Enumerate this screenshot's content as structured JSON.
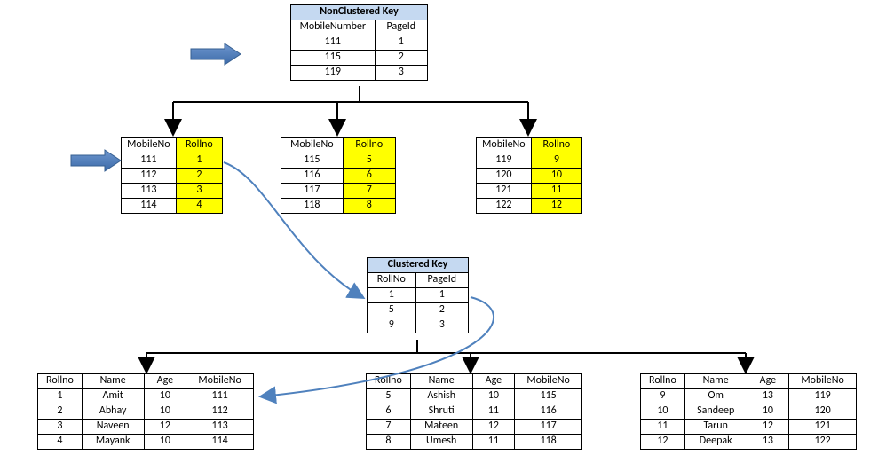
{
  "nonclustered": {
    "title": "NonClustered Key",
    "cols": [
      "MobileNumber",
      "PageId"
    ],
    "rows": [
      [
        "111",
        "1"
      ],
      [
        "115",
        "2"
      ],
      [
        "119",
        "3"
      ]
    ]
  },
  "leaf_nc": {
    "cols": [
      "MobileNo",
      "Rollno"
    ],
    "pages": [
      [
        [
          "111",
          "1"
        ],
        [
          "112",
          "2"
        ],
        [
          "113",
          "3"
        ],
        [
          "114",
          "4"
        ]
      ],
      [
        [
          "115",
          "5"
        ],
        [
          "116",
          "6"
        ],
        [
          "117",
          "7"
        ],
        [
          "118",
          "8"
        ]
      ],
      [
        [
          "119",
          "9"
        ],
        [
          "120",
          "10"
        ],
        [
          "121",
          "11"
        ],
        [
          "122",
          "12"
        ]
      ]
    ]
  },
  "clustered": {
    "title": "Clustered Key",
    "cols": [
      "RollNo",
      "PageId"
    ],
    "rows": [
      [
        "1",
        "1"
      ],
      [
        "5",
        "2"
      ],
      [
        "9",
        "3"
      ]
    ]
  },
  "data_pages": {
    "cols": [
      "Rollno",
      "Name",
      "Age",
      "MobileNo"
    ],
    "pages": [
      [
        [
          "1",
          "Amit",
          "10",
          "111"
        ],
        [
          "2",
          "Abhay",
          "10",
          "112"
        ],
        [
          "3",
          "Naveen",
          "12",
          "113"
        ],
        [
          "4",
          "Mayank",
          "10",
          "114"
        ]
      ],
      [
        [
          "5",
          "Ashish",
          "10",
          "115"
        ],
        [
          "6",
          "Shruti",
          "11",
          "116"
        ],
        [
          "7",
          "Mateen",
          "12",
          "117"
        ],
        [
          "8",
          "Umesh",
          "11",
          "118"
        ]
      ],
      [
        [
          "9",
          "Om",
          "13",
          "119"
        ],
        [
          "10",
          "Sandeep",
          "10",
          "120"
        ],
        [
          "11",
          "Tarun",
          "12",
          "121"
        ],
        [
          "12",
          "Deepak",
          "13",
          "122"
        ]
      ]
    ]
  },
  "colors": {
    "arrow_blue": "#4f81bd",
    "curve_blue": "#4f81bd",
    "header_fill": "#c5d9f1",
    "highlight": "#ffff00"
  },
  "chart_data": {
    "type": "table",
    "description": "Database index diagram showing a NonClustered index on MobileNumber pointing to leaf pages (MobileNo→Rollno), which in turn resolve via a Clustered index on RollNo to data pages containing (Rollno, Name, Age, MobileNo).",
    "nonclustered_index": {
      "key": "MobileNumber",
      "entries": [
        {
          "MobileNumber": 111,
          "PageId": 1
        },
        {
          "MobileNumber": 115,
          "PageId": 2
        },
        {
          "MobileNumber": 119,
          "PageId": 3
        }
      ]
    },
    "nonclustered_leaf_pages": [
      [
        {
          "MobileNo": 111,
          "Rollno": 1
        },
        {
          "MobileNo": 112,
          "Rollno": 2
        },
        {
          "MobileNo": 113,
          "Rollno": 3
        },
        {
          "MobileNo": 114,
          "Rollno": 4
        }
      ],
      [
        {
          "MobileNo": 115,
          "Rollno": 5
        },
        {
          "MobileNo": 116,
          "Rollno": 6
        },
        {
          "MobileNo": 117,
          "Rollno": 7
        },
        {
          "MobileNo": 118,
          "Rollno": 8
        }
      ],
      [
        {
          "MobileNo": 119,
          "Rollno": 9
        },
        {
          "MobileNo": 120,
          "Rollno": 10
        },
        {
          "MobileNo": 121,
          "Rollno": 11
        },
        {
          "MobileNo": 122,
          "Rollno": 12
        }
      ]
    ],
    "clustered_index": {
      "key": "RollNo",
      "entries": [
        {
          "RollNo": 1,
          "PageId": 1
        },
        {
          "RollNo": 5,
          "PageId": 2
        },
        {
          "RollNo": 9,
          "PageId": 3
        }
      ]
    },
    "data_pages": [
      [
        {
          "Rollno": 1,
          "Name": "Amit",
          "Age": 10,
          "MobileNo": 111
        },
        {
          "Rollno": 2,
          "Name": "Abhay",
          "Age": 10,
          "MobileNo": 112
        },
        {
          "Rollno": 3,
          "Name": "Naveen",
          "Age": 12,
          "MobileNo": 113
        },
        {
          "Rollno": 4,
          "Name": "Mayank",
          "Age": 10,
          "MobileNo": 114
        }
      ],
      [
        {
          "Rollno": 5,
          "Name": "Ashish",
          "Age": 10,
          "MobileNo": 115
        },
        {
          "Rollno": 6,
          "Name": "Shruti",
          "Age": 11,
          "MobileNo": 116
        },
        {
          "Rollno": 7,
          "Name": "Mateen",
          "Age": 12,
          "MobileNo": 117
        },
        {
          "Rollno": 8,
          "Name": "Umesh",
          "Age": 11,
          "MobileNo": 118
        }
      ],
      [
        {
          "Rollno": 9,
          "Name": "Om",
          "Age": 13,
          "MobileNo": 119
        },
        {
          "Rollno": 10,
          "Name": "Sandeep",
          "Age": 10,
          "MobileNo": 120
        },
        {
          "Rollno": 11,
          "Name": "Tarun",
          "Age": 12,
          "MobileNo": 121
        },
        {
          "Rollno": 12,
          "Name": "Deepak",
          "Age": 13,
          "MobileNo": 122
        }
      ]
    ]
  }
}
